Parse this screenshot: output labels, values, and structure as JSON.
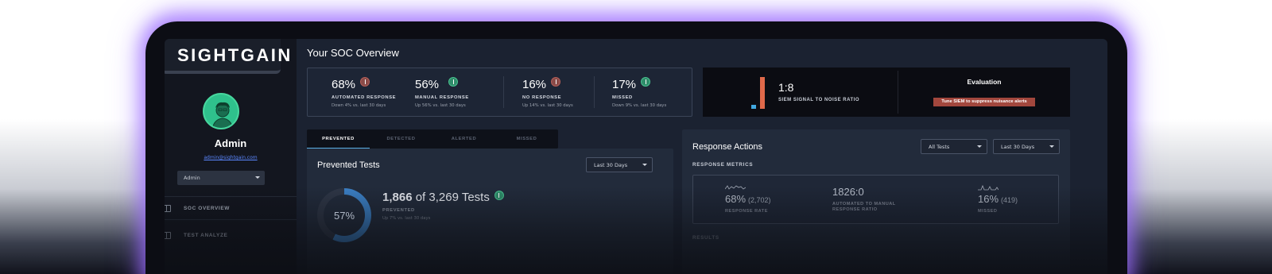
{
  "brand": {
    "logo_text": "SIGHTGAIN"
  },
  "user": {
    "name": "Admin",
    "email": "admin@sightgain.com",
    "role": "Admin"
  },
  "nav": [
    {
      "label": "SOC OVERVIEW",
      "icon": "layout-icon"
    },
    {
      "label": "TEST ANALYZE",
      "icon": "analyze-icon"
    }
  ],
  "page": {
    "title": "Your SOC Overview"
  },
  "stats": [
    {
      "value": "68%",
      "trend": "down",
      "label": "AUTOMATED RESPONSE",
      "sub": "Down 4% vs. last 30 days"
    },
    {
      "value": "56%",
      "trend": "up",
      "label": "MANUAL RESPONSE",
      "sub": "Up 56% vs. last 30 days"
    },
    {
      "value": "16%",
      "trend": "down",
      "label": "NO RESPONSE",
      "sub": "Up 14% vs. last 30 days"
    },
    {
      "value": "17%",
      "trend": "up",
      "label": "MISSED",
      "sub": "Down 9% vs. last 30 days"
    }
  ],
  "signal": {
    "ratio": "1:8",
    "label": "SIEM SIGNAL TO NOISE RATIO",
    "evaluation_title": "Evaluation",
    "evaluation_badge": "Tune SIEM to suppress nuisance alerts",
    "badge_color": "#a2473d"
  },
  "tabs": [
    "PREVENTED",
    "DETECTED",
    "ALERTED",
    "MISSED"
  ],
  "active_tab": "PREVENTED",
  "prevented": {
    "title": "Prevented Tests",
    "range": "Last 30 Days",
    "percent_label": "57%",
    "percent_value": 0.57,
    "count": "1,866",
    "total_text": "of 3,269 Tests",
    "label": "PREVENTED",
    "sub": "Up 7% vs. last 30 days"
  },
  "response": {
    "title": "Response Actions",
    "filter_tests": "All Tests",
    "filter_range": "Last 30 Days",
    "metrics_heading": "RESPONSE METRICS",
    "metrics": [
      {
        "value": "68%",
        "count": "(2,702)",
        "label": "RESPONSE RATE"
      },
      {
        "value": "1826:0",
        "count": "",
        "label": "AUTOMATED TO MANUAL RESPONSE RATIO"
      },
      {
        "value": "16%",
        "count": "(419)",
        "label": "MISSED"
      }
    ],
    "results_heading": "RESULTS"
  },
  "colors": {
    "accent": "#5ab0e5",
    "glow": "#9d6eff",
    "up": "#2f8c6a",
    "down": "#8a4b48"
  }
}
